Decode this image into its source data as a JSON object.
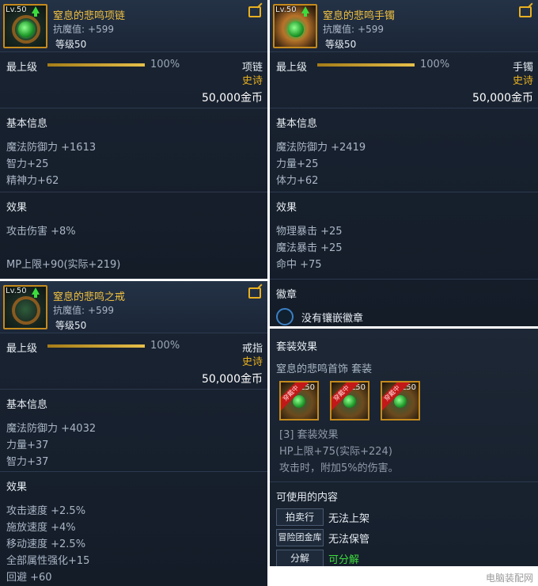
{
  "panels": {
    "necklace": {
      "level_badge": "Lv.50",
      "name": "窒息的悲鸣项链",
      "stat_label": "抗魔值:",
      "stat_value": "+599",
      "level_text": "等级50",
      "top_label": "最上级",
      "progress_fraction": 1.0,
      "progress_text": "100%",
      "slot": "项链",
      "rarity": "史诗",
      "price": "50,000金币",
      "basic_title": "基本信息",
      "basic": [
        "魔法防御力 +1613",
        "智力+25",
        "精神力+62"
      ],
      "effect_title": "效果",
      "effects": [
        "攻击伤害 +8%",
        "",
        "MP上限+90(实际+219)"
      ]
    },
    "bracelet": {
      "level_badge": "Lv.50",
      "name": "窒息的悲鸣手镯",
      "stat_label": "抗魔值:",
      "stat_value": "+599",
      "level_text": "等级50",
      "top_label": "最上级",
      "progress_fraction": 1.0,
      "progress_text": "100%",
      "slot": "手镯",
      "rarity": "史诗",
      "price": "50,000金币",
      "basic_title": "基本信息",
      "basic": [
        "魔法防御力 +2419",
        "力量+25",
        "体力+62"
      ],
      "effect_title": "效果",
      "effects": [
        "物理暴击 +25",
        "魔法暴击 +25",
        "命中 +75"
      ],
      "emblem_title": "徽章",
      "emblem_text": "没有镶嵌徽章"
    },
    "ring": {
      "level_badge": "Lv.50",
      "name": "窒息的悲鸣之戒",
      "stat_label": "抗魔值:",
      "stat_value": "+599",
      "level_text": "等级50",
      "top_label": "最上级",
      "progress_fraction": 1.0,
      "progress_text": "100%",
      "slot": "戒指",
      "rarity": "史诗",
      "price": "50,000金币",
      "basic_title": "基本信息",
      "basic": [
        "魔法防御力 +4032",
        "力量+37",
        "智力+37"
      ],
      "effect_title": "效果",
      "effects": [
        "攻击速度 +2.5%",
        "施放速度 +4%",
        "移动速度 +2.5%",
        "全部属性强化+15",
        "回避 +60"
      ]
    },
    "set": {
      "title": "套装效果",
      "set_name": "窒息的悲鸣首饰 套装",
      "icons": [
        {
          "ribbon": "穿戴中",
          "level": "L50"
        },
        {
          "ribbon": "穿戴中",
          "level": "L50"
        },
        {
          "ribbon": "穿戴中",
          "level": "L50"
        }
      ],
      "effect_header": "[3] 套装效果",
      "effect_lines": [
        "HP上限+75(实际+224)",
        "攻击时，附加5%的伤害。"
      ],
      "usable_title": "可使用的内容",
      "usable": [
        {
          "button": "拍卖行",
          "value": "无法上架",
          "ok": false
        },
        {
          "button": "冒险团金库",
          "value": "无法保管",
          "ok": false
        },
        {
          "button": "分解",
          "value": "可分解",
          "ok": true
        }
      ]
    }
  },
  "watermark": "电脑装配网",
  "colors": {
    "gold": "#f0c040",
    "epic": "#e8b020",
    "ok_green": "#3ddc3d",
    "panel_bg": "#1a2433"
  }
}
